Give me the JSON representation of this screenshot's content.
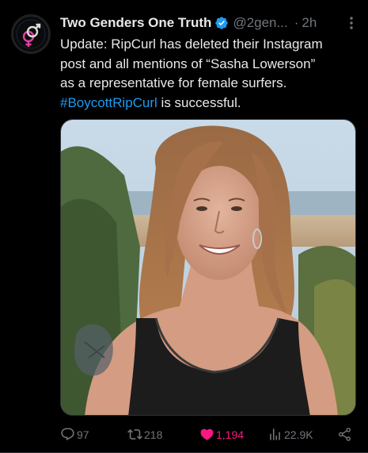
{
  "post": {
    "author_name": "Two Genders One Truth",
    "handle": "@2gen...",
    "separator": "·",
    "time": "2h",
    "text_lines": [
      "Update: RipCurl has deleted their Instagram",
      "post and all mentions of “Sasha Lowerson”",
      "as a representative for female surfers."
    ],
    "hashtag": "#BoycottRipCurl",
    "text_tail": " is successful.",
    "image_alt": "photo"
  },
  "actions": {
    "replies": "97",
    "reposts": "218",
    "likes": "1,194",
    "views": "22.9K"
  },
  "colors": {
    "background": "#000000",
    "text": "#e7e9ea",
    "muted": "#71767b",
    "link": "#1d9bf0",
    "like": "#f91880",
    "verified": "#1d9bf0"
  },
  "icons": {
    "avatar": "gender-symbols-logo",
    "verified": "verified-badge-icon",
    "more": "more-dots-icon",
    "reply": "reply-icon",
    "repost": "repost-icon",
    "like": "heart-filled-icon",
    "views": "views-chart-icon",
    "share": "share-icon"
  }
}
